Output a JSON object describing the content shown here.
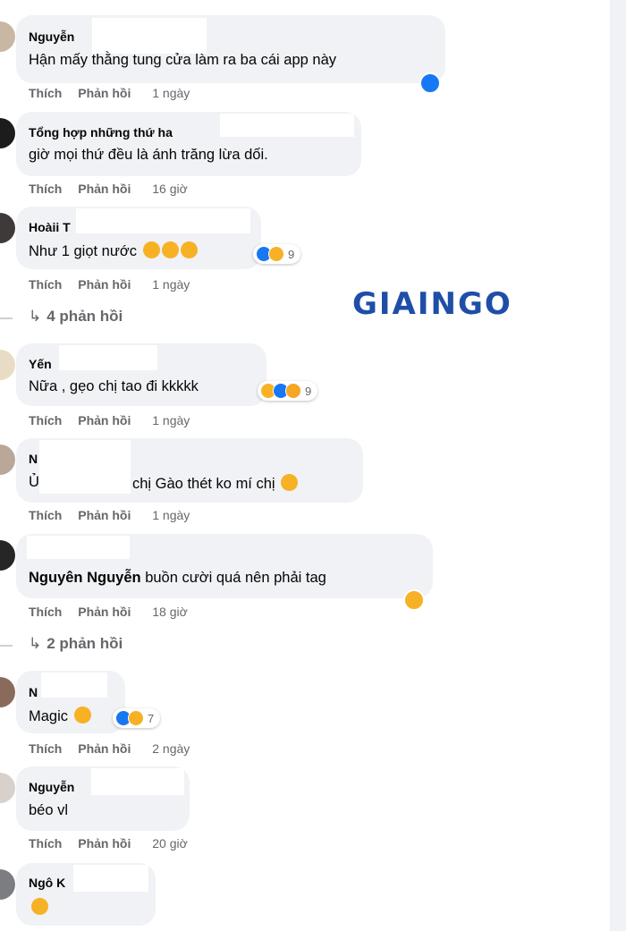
{
  "actions": {
    "like": "Thích",
    "reply": "Phản hồi"
  },
  "watermark": "GIAINGO",
  "colors": {
    "bubble": "#f0f2f5",
    "like": "#1877f2",
    "haha": "#f7b125",
    "meta": "#65676b"
  },
  "comments": [
    {
      "name": "Nguyễn",
      "text": "Hận mấy thằng tung cửa làm ra ba cái app này",
      "time": "1 ngày"
    },
    {
      "name": "Tổng hợp những thứ ha",
      "text": "giờ mọi thứ đều là ánh trăng lừa dối.",
      "time": "16 giờ"
    },
    {
      "name": "Hoàii T",
      "text": "Như 1 giọt nước",
      "time": "1 ngày",
      "reaction_count": "9",
      "replies": "4 phản hồi"
    },
    {
      "name": "Yến",
      "text": "Nữa , gẹo chị tao đi kkkkk",
      "time": "1 ngày",
      "reaction_count": "9"
    },
    {
      "name": "N",
      "text_prefix": "Ủ",
      "text": "chị Gào thét ko mí chị",
      "time": "1 ngày"
    },
    {
      "name": "",
      "tag": "Nguyên Nguyễn",
      "text": "buồn cười quá nên phải tag",
      "time": "18 giờ",
      "replies": "2 phản hồi"
    },
    {
      "name": "N",
      "text": "Magic",
      "time": "2 ngày",
      "reaction_count": "7"
    },
    {
      "name": "Nguyễn",
      "text": "béo vl",
      "time": "20 giờ"
    },
    {
      "name": "Ngô K",
      "text": ""
    }
  ]
}
